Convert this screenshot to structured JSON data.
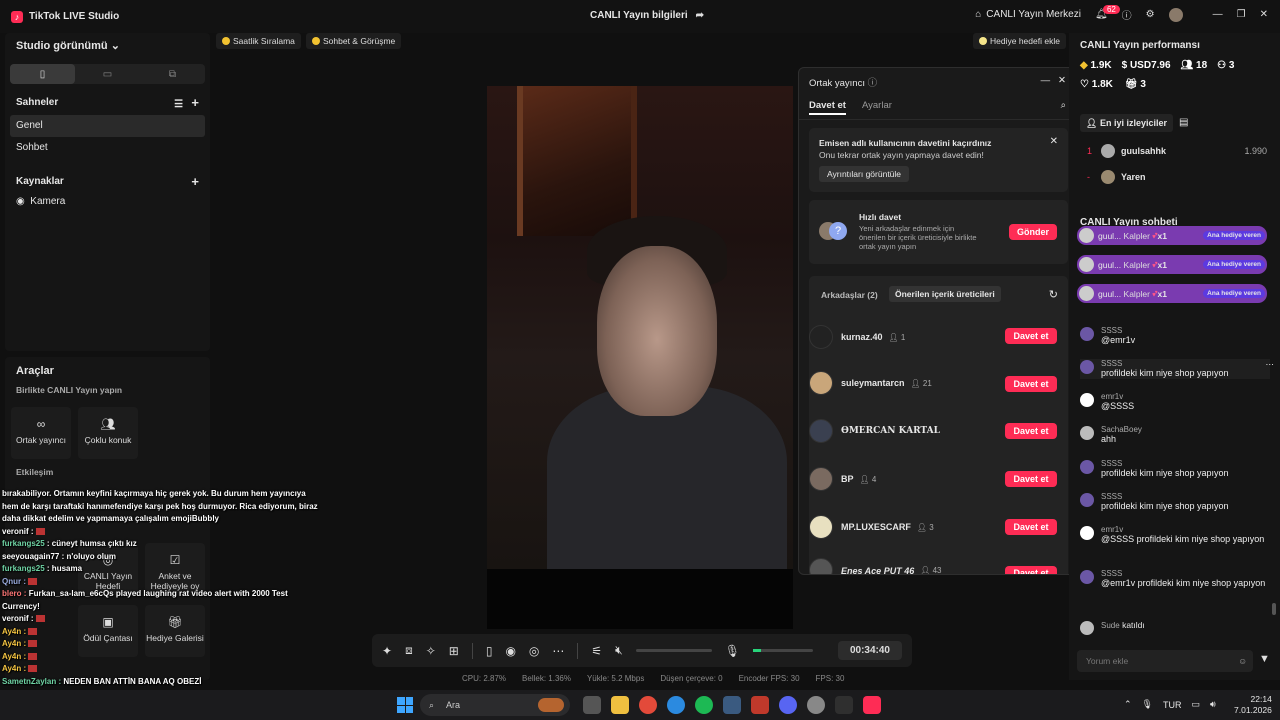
{
  "app": {
    "title": "TikTok LIVE Studio",
    "center_title": "CANLI Yayın bilgileri",
    "live_center": "CANLI Yayın Merkezi",
    "notif_count": "62"
  },
  "left": {
    "studio_view": "Studio görünümü",
    "scenes_label": "Sahneler",
    "scenes": [
      "Genel",
      "Sohbet"
    ],
    "sources_label": "Kaynaklar",
    "sources": [
      "Kamera"
    ],
    "tools_label": "Araçlar",
    "together_label": "Birlikte CANLI Yayın yapın",
    "cohost_label": "Ortak yayıncı",
    "multi_guest_label": "Çoklu konuk",
    "interaction_label": "Etkileşim",
    "live_goal_label": "CANLI Yayın Hedefi",
    "poll_label": "Anket ve Hediyeyle oy",
    "reward_bag_label": "Ödül Çantası",
    "gift_gallery_label": "Hediye Galerisi"
  },
  "chips": {
    "hourly": "Saatlik Sıralama",
    "chat_meet": "Sohbet & Görüşme",
    "gift_goal": "Hediye hedefi ekle"
  },
  "overlay_chat": [
    {
      "user": "",
      "text": "bırakabiliyor. Ortamın keyfini kaçırmaya hiç gerek yok. Bu durum hem yayıncıya hem de karşı taraftaki hanımefendiye karşı pek hoş durmuyor. Rica ediyorum, biraz daha dikkat edelim ve yapmamaya çalışalım emojiBubbly"
    },
    {
      "user": "veronif :",
      "text": ""
    },
    {
      "user": "furkangs25",
      "text": ": cüneyt humsa çıktı kız"
    },
    {
      "user": "seeyouagain77",
      "text": ": n'oluyo olum"
    },
    {
      "user": "furkangs25",
      "text": ": husama"
    },
    {
      "user": "Qnur :",
      "text": ""
    },
    {
      "user": "blero :",
      "text": "Furkan_sa-lam_e6cQs played laughing rat video alert with 2000 Test Currency!"
    },
    {
      "user": "veronif :",
      "text": ""
    },
    {
      "user": "Ay4n :",
      "text": ""
    },
    {
      "user": "Ay4n :",
      "text": ""
    },
    {
      "user": "Ay4n :",
      "text": ""
    },
    {
      "user": "Ay4n :",
      "text": ""
    },
    {
      "user": "SametnZaylan :",
      "text": "NEDEN BAN ATTİN BANA AQ OBEZİ"
    }
  ],
  "controls": {
    "timer": "00:34:40"
  },
  "status": {
    "cpu": "CPU: 2.87%",
    "mem": "Bellek: 1.36%",
    "upload": "Yükle: 5.2 Mbps",
    "dropped": "Düşen çerçeve: 0",
    "encoder_fps": "Encoder FPS: 30",
    "fps": "FPS: 30"
  },
  "modal": {
    "title": "Ortak yayıncı",
    "tab_invite": "Davet et",
    "tab_settings": "Ayarlar",
    "missed_title": "Emisen adlı kullanıcının davetini kaçırdınız",
    "missed_sub": "Onu tekrar ortak yayın yapmaya davet edin!",
    "missed_btn": "Ayrıntıları görüntüle",
    "quick_title": "Hızlı davet",
    "quick_desc": "Yeni arkadaşlar edinmek için önerilen bir içerik üreticisiyle birlikte ortak yayın yapın",
    "send": "Gönder",
    "friends_tab": "Arkadaşlar (2)",
    "suggested_tab": "Önerilen içerik üreticileri",
    "invite": "Davet et",
    "friends": [
      {
        "name": "kurnaz.40",
        "count": "1"
      },
      {
        "name": "suleymantarcn",
        "count": "21"
      },
      {
        "name": "ƟMERCAN KARTAL",
        "count": ""
      },
      {
        "name": "BP",
        "count": "4"
      },
      {
        "name": "MP.LUXESCARF",
        "count": "3"
      },
      {
        "name": "Enes Ace PUT 46",
        "count": "43"
      }
    ]
  },
  "right": {
    "perf_title": "CANLI Yayın performansı",
    "stats": {
      "coins": "1.9K",
      "usd": "USD7.96",
      "viewers": "18",
      "guests": "3",
      "likes": "1.8K",
      "gifts": "3"
    },
    "top_viewers_label": "En iyi izleyiciler",
    "top": [
      {
        "rank": "1",
        "name": "guulsahhk",
        "score": "1.990"
      },
      {
        "rank": "-",
        "name": "Yaren",
        "score": ""
      }
    ],
    "chat_title": "CANLI Yayın sohbeti",
    "gifts": [
      {
        "user": "guul...",
        "item": "Kalpler",
        "x": "x1",
        "tag": "Ana hediye veren"
      },
      {
        "user": "guul...",
        "item": "Kalpler",
        "x": "x1",
        "tag": "Ana hediye veren"
      },
      {
        "user": "guul...",
        "item": "Kalpler",
        "x": "x1",
        "tag": "Ana hediye veren"
      }
    ],
    "comments": [
      {
        "user": "SSSS",
        "text": "@emr1v"
      },
      {
        "user": "SSSS",
        "text": "profildeki kim niye shop yapıyon"
      },
      {
        "user": "emr1v",
        "text": "@SSSS"
      },
      {
        "user": "SachaBoey",
        "text": "ahh"
      },
      {
        "user": "SSSS",
        "text": "profildeki kim niye shop yapıyon"
      },
      {
        "user": "SSSS",
        "text": "profildeki kim niye shop yapıyon"
      },
      {
        "user": "emr1v",
        "text": "@SSSS profildeki kim niye shop yapıyon"
      },
      {
        "user": "SSSS",
        "text": "@emr1v profildeki kim niye shop yapıyon"
      }
    ],
    "joined_user": "Sude",
    "joined_text": "katıldı",
    "comment_placeholder": "Yorum ekle"
  },
  "taskbar": {
    "search": "Ara",
    "lang": "TUR",
    "time": "22:14",
    "date": "7.01.2026"
  }
}
